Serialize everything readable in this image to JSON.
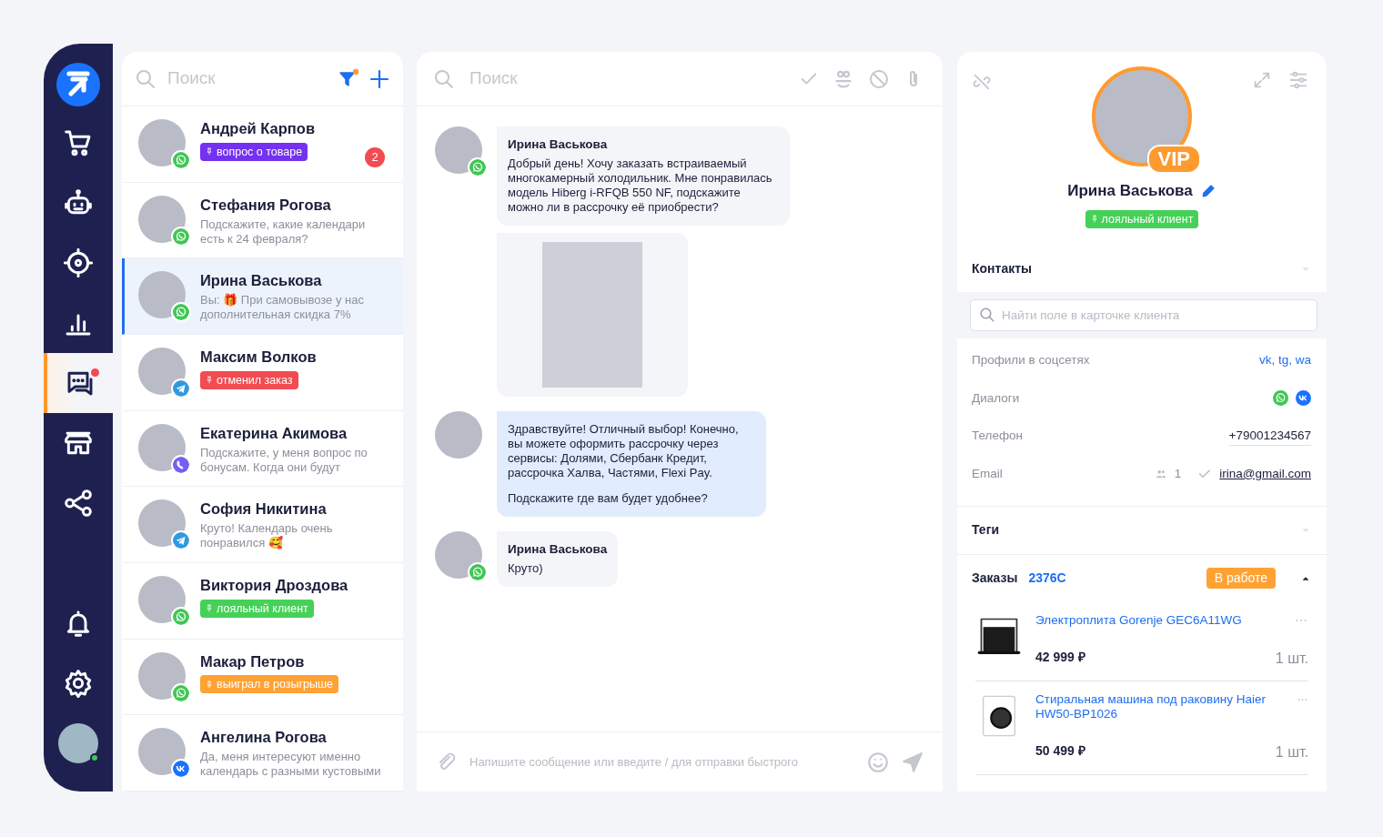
{
  "nav_top": [
    {
      "kind": "logo",
      "selected": false,
      "notification": false
    },
    {
      "kind": "cart",
      "selected": false,
      "notification": false
    },
    {
      "kind": "robot",
      "selected": false,
      "notification": false
    },
    {
      "kind": "target",
      "selected": false,
      "notification": false
    },
    {
      "kind": "chart",
      "selected": false,
      "notification": false
    },
    {
      "kind": "chat",
      "selected": true,
      "notification": true
    },
    {
      "kind": "store",
      "selected": false,
      "notification": false
    },
    {
      "kind": "share",
      "selected": false,
      "notification": false
    }
  ],
  "nav_bottom": [
    {
      "kind": "bell",
      "selected": false,
      "notification": false
    },
    {
      "kind": "gear",
      "selected": false,
      "notification": false
    },
    {
      "kind": "user",
      "selected": false,
      "notification": false,
      "online": true
    }
  ],
  "contacts": {
    "search": {
      "placeholder": "Поиск"
    },
    "filter_active": true,
    "items": [
      {
        "name": "Андрей Карпов",
        "channel": {
          "kind": "whatsapp"
        },
        "tag": {
          "text": "вопрос о товаре",
          "color": "#7431f0"
        },
        "unread": "2",
        "selected": false
      },
      {
        "name": "Стефания Рогова",
        "channel": {
          "kind": "whatsapp"
        },
        "preview": "Подскажите, какие календари есть к 24 февраля?",
        "selected": false
      },
      {
        "name": "Ирина Васькова",
        "channel": {
          "kind": "whatsapp"
        },
        "preview": "Вы: 🎁 При самовывозе у нас дополнительная скидка 7%",
        "selected": true
      },
      {
        "name": "Максим Волков",
        "channel": {
          "kind": "telegram"
        },
        "tag": {
          "text": "отменил заказ",
          "color": "#f24b52"
        },
        "selected": false
      },
      {
        "name": "Екатерина Акимова",
        "channel": {
          "kind": "viber"
        },
        "preview": "Подскажите, у меня вопрос по бонусам. Когда они будут",
        "selected": false
      },
      {
        "name": "София Никитина",
        "channel": {
          "kind": "telegram"
        },
        "preview": "Круто! Календарь очень понравился 🥰",
        "selected": false
      },
      {
        "name": "Виктория Дроздова",
        "channel": {
          "kind": "whatsapp"
        },
        "tag": {
          "text": "лояльный клиент",
          "color": "#45d157"
        },
        "selected": false
      },
      {
        "name": "Макар Петров",
        "channel": {
          "kind": "whatsapp"
        },
        "tag": {
          "text": "выиграл в розыгрыше",
          "color": "#ffa234"
        },
        "selected": false
      },
      {
        "name": "Ангелина Рогова",
        "channel": {
          "kind": "vk"
        },
        "preview": "Да, меня интересуют именно календарь с разными кустовыми",
        "selected": false
      }
    ]
  },
  "chat": {
    "search": {
      "placeholder": "Поиск"
    },
    "messages": [
      {
        "kind": "incoming",
        "author": "Ирина Васькова",
        "channel": {
          "kind": "whatsapp"
        },
        "paragraphs": [
          "Добрый день! Хочу заказать встраиваемый многокамерный холодильник. Мне понравилась модель Hiberg i-RFQB 550 NF, подскажите можно ли в рассрочку её приобрести?"
        ]
      },
      {
        "kind": "image"
      },
      {
        "kind": "outgoing",
        "paragraphs": [
          "Здравствуйте! Отличный выбор! Конечно, вы можете оформить рассрочку через сервисы: Долями, Сбербанк Кредит, рассрочка Халва, Частями, Flexi Pay.",
          "Подскажите где вам будет удобнее?"
        ]
      },
      {
        "kind": "incoming",
        "author": "Ирина Васькова",
        "channel": {
          "kind": "whatsapp"
        },
        "paragraphs": [
          "Круто)"
        ]
      }
    ],
    "composer": {
      "placeholder": "Напишите сообщение или введите / для отправки быстрого"
    }
  },
  "client": {
    "name": "Ирина Васькова",
    "badge": "VIP",
    "tag": {
      "text": "лояльный клиент",
      "color": "#45d157"
    },
    "contacts": {
      "title": "Контакты",
      "search_placeholder": "Найти поле в карточке клиента",
      "fields": [
        {
          "kind": "link",
          "label": "Профили в соцсетях",
          "value": "vk, tg, wa"
        },
        {
          "kind": "channels",
          "label": "Диалоги",
          "channels": [
            {
              "kind": "whatsapp"
            },
            {
              "kind": "vk"
            }
          ]
        },
        {
          "kind": "text",
          "label": "Телефон",
          "value": "+79001234567"
        },
        {
          "kind": "email",
          "label": "Email",
          "count": "1",
          "verified": true,
          "value": "irina@gmail.com"
        }
      ]
    },
    "tags": {
      "title": "Теги"
    },
    "orders": {
      "title": "Заказы",
      "number": "2376C",
      "status": "В работе",
      "expanded": true,
      "items": [
        {
          "kind": "oven",
          "name": "Электроплита Gorenje GEC6A11WG",
          "price": "42 999 ₽",
          "qty": "1 шт."
        },
        {
          "kind": "washer",
          "name": "Стиральная машина под раковину Haier HW50-BP1026",
          "price": "50 499 ₽",
          "qty": "1 шт."
        }
      ]
    }
  }
}
